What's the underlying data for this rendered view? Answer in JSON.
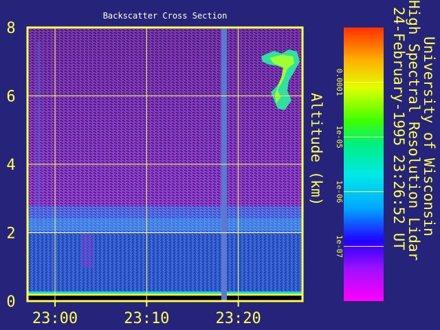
{
  "header": {
    "institution": "University of Wisconsin",
    "instrument": "High Spectral Resolution Lidar",
    "timestamp": "24-February-1995 23:26:52 UT"
  },
  "chart_data": {
    "type": "heatmap",
    "title": "Backscatter Cross Section",
    "xlabel": "",
    "ylabel": "Altitude (km)",
    "x_ticks": [
      "23:00",
      "23:10",
      "23:20"
    ],
    "x_range": [
      "22:57",
      "23:27"
    ],
    "y_ticks": [
      0,
      2,
      4,
      6,
      8
    ],
    "ylim": [
      0,
      8
    ],
    "grid": true,
    "colorbar": {
      "scale": "log",
      "ticks": [
        "0.0001",
        "1e-05",
        "1e-06",
        "1e-07"
      ],
      "range": [
        1e-08,
        0.001
      ]
    },
    "features": [
      {
        "name": "boundary layer",
        "altitude_km": [
          0.2,
          2.4
        ]
      },
      {
        "name": "cloud",
        "time": "23:25",
        "altitude_km": [
          5.8,
          7.3
        ]
      }
    ],
    "data_gap_time": "23:18.5"
  },
  "colors": {
    "background": "#26247a",
    "axis": "#ffff54",
    "grid": "#ffff54",
    "text": "#ffff54",
    "title": "#ffffff"
  }
}
